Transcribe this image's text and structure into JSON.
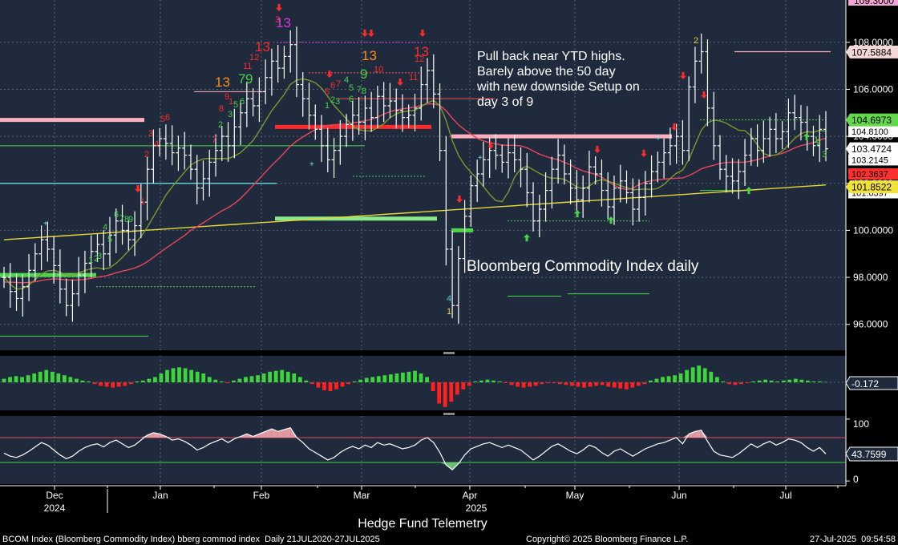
{
  "chart_data": {
    "type": "line",
    "title": "Bloomberg Commodity Index daily",
    "annotation": [
      "Pull back near YTD highs.",
      "Barely above the 50 day",
      "with new downside Setup on",
      "day 3 of 9"
    ],
    "x_months": [
      "Dec",
      "Jan",
      "Feb",
      "Mar",
      "Apr",
      "May",
      "Jun",
      "Jul"
    ],
    "x_years": [
      "2024",
      "2025"
    ],
    "price_panel": {
      "ylim": [
        94.9,
        109.8
      ],
      "y_ticks": [
        "96.0000",
        "98.0000",
        "100.0000",
        "102.0000",
        "104.0000",
        "106.0000",
        "108.0000"
      ],
      "top_tag": "109.3000",
      "price_tags": [
        {
          "label": "107.5884",
          "value": 107.5884,
          "bg": "#f5d7d7",
          "fg": "#000000"
        },
        {
          "label": "104.6973",
          "value": 104.6973,
          "bg": "#63d84a",
          "fg": "#000000"
        },
        {
          "label": "103.4724",
          "value": 103.4724,
          "bg": "#ffffff",
          "fg": "#000000"
        },
        {
          "label": "101.8522",
          "value": 101.8522,
          "bg": "#f2e23a",
          "fg": "#000000"
        }
      ],
      "partial_tags": [
        {
          "label": "104.8100",
          "value": 104.2,
          "bg": "#ffffff"
        },
        {
          "label": "103.2145",
          "value": 103.0,
          "bg": "#ffffff"
        },
        {
          "label": "102.3637",
          "value": 102.4,
          "bg": "#ff3030"
        },
        {
          "label": "101.6397",
          "value": 101.6,
          "bg": "#ffffff"
        }
      ],
      "close_series": [
        98.0,
        97.4,
        97.1,
        97.6,
        98.3,
        99.0,
        99.6,
        99.2,
        98.5,
        97.5,
        96.8,
        97.3,
        98.1,
        98.6,
        99.1,
        99.4,
        99.0,
        99.8,
        100.4,
        100.0,
        99.6,
        100.2,
        101.2,
        102.6,
        103.6,
        103.9,
        103.7,
        103.3,
        103.5,
        103.2,
        102.6,
        101.8,
        102.2,
        102.9,
        103.4,
        104.0,
        103.6,
        104.4,
        105.0,
        105.6,
        105.3,
        105.9,
        106.5,
        107.2,
        106.9,
        107.4,
        107.9,
        106.2,
        105.6,
        104.9,
        104.3,
        103.6,
        103.0,
        103.4,
        104.0,
        104.5,
        104.9,
        104.6,
        105.2,
        104.8,
        105.7,
        105.3,
        105.5,
        105.1,
        104.8,
        104.9,
        105.2,
        106.2,
        106.8,
        105.8,
        103.4,
        99.2,
        96.8,
        98.8,
        100.6,
        101.9,
        102.4,
        103.0,
        103.4,
        103.2,
        102.9,
        103.3,
        103.0,
        102.6,
        101.6,
        100.4,
        100.9,
        101.7,
        102.6,
        103.2,
        102.4,
        101.8,
        101.3,
        101.8,
        102.7,
        102.4,
        101.7,
        101.0,
        101.8,
        102.1,
        101.6,
        100.9,
        101.4,
        102.0,
        102.5,
        102.9,
        103.3,
        103.6,
        104.0,
        103.4,
        106.1,
        107.2,
        107.6,
        105.2,
        103.6,
        102.6,
        102.3,
        102.1,
        102.5,
        103.2,
        103.9,
        103.4,
        103.9,
        104.3,
        103.9,
        104.2,
        105.0,
        104.8,
        104.6,
        104.0,
        103.6,
        104.3,
        103.47
      ],
      "series": [
        {
          "name": "",
          "color": "#ffffff"
        },
        {
          "name": "",
          "color": "#e8455a"
        },
        {
          "name": "",
          "color": "#7a9a2e"
        },
        {
          "name": "",
          "color": "#e8d83a"
        }
      ]
    },
    "macd_panel": {
      "value_label": "-0.172",
      "histogram": [
        0.2,
        0.3,
        0.35,
        0.3,
        0.4,
        0.5,
        0.6,
        0.7,
        0.6,
        0.5,
        0.4,
        0.3,
        0.2,
        0.1,
        0.05,
        -0.1,
        -0.2,
        -0.25,
        -0.3,
        -0.25,
        -0.2,
        -0.1,
        0.05,
        0.1,
        0.2,
        0.3,
        0.5,
        0.7,
        0.8,
        0.85,
        0.8,
        0.7,
        0.6,
        0.5,
        0.3,
        0.15,
        0.05,
        -0.05,
        0.1,
        0.2,
        0.3,
        0.35,
        0.4,
        0.5,
        0.6,
        0.65,
        0.7,
        0.6,
        0.5,
        0.3,
        0.1,
        -0.1,
        -0.3,
        -0.45,
        -0.5,
        -0.4,
        -0.25,
        -0.1,
        0.05,
        0.15,
        0.25,
        0.3,
        0.35,
        0.4,
        0.45,
        0.5,
        0.55,
        0.6,
        0.65,
        0.5,
        0.3,
        -0.5,
        -1.2,
        -1.4,
        -1.1,
        -0.7,
        -0.4,
        -0.2,
        0.05,
        0.1,
        0.15,
        0.1,
        0.05,
        -0.05,
        -0.15,
        -0.25,
        -0.3,
        -0.25,
        -0.2,
        -0.1,
        -0.05,
        -0.05,
        -0.1,
        -0.15,
        -0.2,
        -0.25,
        -0.3,
        -0.25,
        -0.2,
        -0.15,
        -0.25,
        -0.3,
        -0.35,
        -0.4,
        -0.3,
        -0.2,
        -0.1,
        0.1,
        0.2,
        0.3,
        0.35,
        0.4,
        0.5,
        0.7,
        0.85,
        0.95,
        0.8,
        0.6,
        0.3,
        0.05,
        -0.1,
        -0.15,
        -0.1,
        -0.05,
        0.05,
        0.1,
        0.15,
        0.1,
        0.05,
        0.1,
        0.15,
        0.2,
        0.15,
        0.1,
        0.05,
        0.05,
        0.02
      ]
    },
    "rsi_panel": {
      "ylim": [
        -5,
        105
      ],
      "y_ticks": [
        "0",
        "100"
      ],
      "value_label": "43.7599",
      "upper": 70,
      "lower": 30,
      "values": [
        45,
        40,
        38,
        42,
        48,
        55,
        62,
        58,
        50,
        42,
        36,
        40,
        48,
        54,
        58,
        60,
        55,
        62,
        66,
        60,
        54,
        58,
        66,
        74,
        78,
        76,
        72,
        66,
        68,
        64,
        58,
        50,
        54,
        60,
        64,
        68,
        62,
        68,
        72,
        76,
        72,
        76,
        80,
        84,
        80,
        83,
        86,
        70,
        62,
        52,
        46,
        40,
        34,
        38,
        46,
        52,
        56,
        52,
        58,
        54,
        62,
        58,
        60,
        56,
        52,
        54,
        58,
        66,
        70,
        62,
        46,
        26,
        18,
        28,
        42,
        52,
        56,
        60,
        62,
        58,
        54,
        58,
        54,
        50,
        42,
        34,
        40,
        48,
        56,
        60,
        54,
        48,
        44,
        50,
        58,
        54,
        46,
        40,
        48,
        52,
        46,
        40,
        46,
        52,
        56,
        60,
        62,
        66,
        70,
        60,
        76,
        80,
        82,
        64,
        48,
        42,
        40,
        38,
        44,
        52,
        60,
        54,
        60,
        64,
        58,
        62,
        68,
        66,
        62,
        54,
        48,
        54,
        43.76
      ]
    }
  },
  "footer": {
    "panel_caption": "Hedge Fund Telemetry",
    "ticker_info": "BCOM Index (Bloomberg Commodity Index) bberg commod index  Daily 21JUL2020-27JUL2025",
    "copyright": "Copyright© 2025 Bloomberg Finance L.P.",
    "timestamp": "27-Jul-2025  09:54:58"
  },
  "colors": {
    "background": "#1f2a3c",
    "frame": "#000000",
    "grid": "#5a6478",
    "axis_text": "#ffffff",
    "buy_count": "#4bd24b",
    "sell_count": "#ff2b2b",
    "count_13": "#ff8c1a",
    "magenta": "#d63bd6",
    "tdst_red": "#ff2b2b",
    "tdst_green": "#8ae88a",
    "tdst_pink": "#ffb0c0"
  }
}
